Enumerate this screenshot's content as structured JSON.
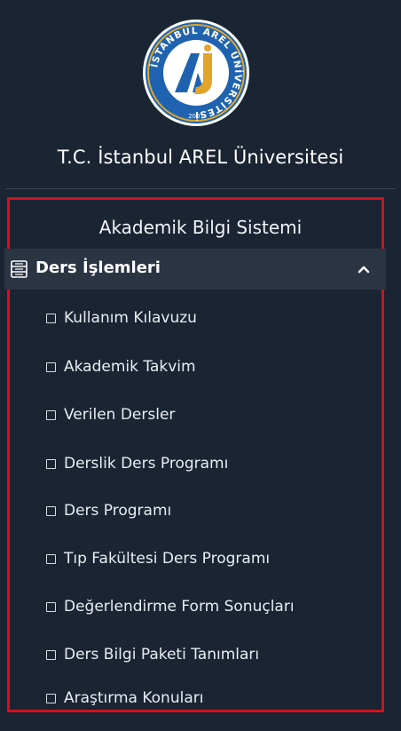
{
  "brand": {
    "university_name": "T.C. İstanbul AREL Üniversitesi",
    "logo_ring_text": "İSTANBUL AREL ÜNİVERSİTESİ",
    "logo_year": "2007"
  },
  "menu": {
    "section_title": "Akademik Bilgi Sistemi",
    "group": {
      "label": "Ders İşlemleri",
      "icon": "list-document-icon",
      "expanded": true,
      "items": [
        {
          "label": "Kullanım Kılavuzu"
        },
        {
          "label": "Akademik Takvim"
        },
        {
          "label": "Verilen Dersler"
        },
        {
          "label": "Derslik Ders Programı"
        },
        {
          "label": "Ders Programı"
        },
        {
          "label": "Tıp Fakültesi Ders Programı"
        },
        {
          "label": "Değerlendirme Form Sonuçları"
        },
        {
          "label": "Ders Bilgi Paketi Tanımları"
        },
        {
          "label": "Araştırma Konuları"
        }
      ]
    }
  },
  "colors": {
    "background": "#1a2433",
    "highlight_border": "#d0121d",
    "group_header_bg": "#2a3443",
    "logo_blue": "#1f63b0",
    "logo_gold": "#e0a52a"
  }
}
